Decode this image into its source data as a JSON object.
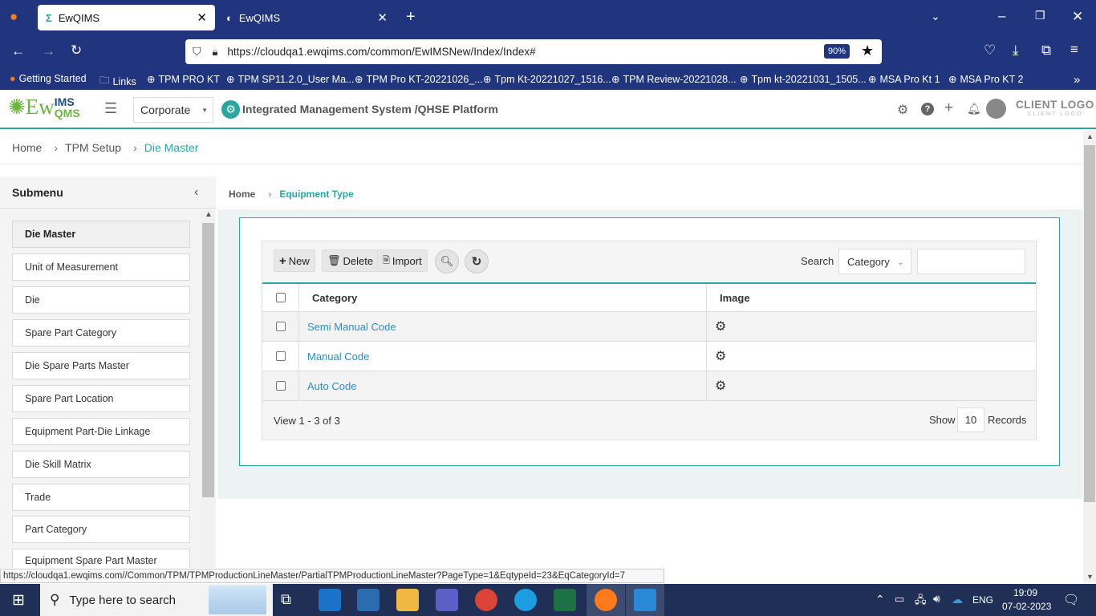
{
  "browser": {
    "tabs": [
      {
        "title": "EwQIMS",
        "active": true
      },
      {
        "title": "EwQIMS",
        "active": false
      }
    ],
    "url": "https://cloudqa1.ewqims.com/common/EwIMSNew/Index/Index#",
    "zoom": "90%",
    "bookmarks": [
      "Getting Started",
      "Links",
      "TPM PRO KT",
      "TPM SP11.2.0_User Ma...",
      "TPM Pro KT-20221026_...",
      "Tpm Kt-20221027_1516...",
      "TPM Review-20221028...",
      "Tpm kt-20221031_1505...",
      "MSA Pro Kt 1",
      "MSA Pro KT 2"
    ]
  },
  "app": {
    "logo_main": "Ew",
    "logo_ims": "IMS",
    "logo_qms": "QMS",
    "org_select": "Corporate",
    "platform_title": "Integrated Management System /QHSE Platform",
    "client_logo": "CLIENT LOGO",
    "client_logo_sub": "CLIENT LOGO"
  },
  "breadcrumb": {
    "home": "Home",
    "setup": "TPM Setup",
    "current": "Die Master"
  },
  "sidebar": {
    "title": "Submenu",
    "items": [
      {
        "label": "Die Master",
        "selected": true
      },
      {
        "label": "Unit of Measurement"
      },
      {
        "label": "Die"
      },
      {
        "label": "Spare Part Category"
      },
      {
        "label": "Die Spare Parts Master"
      },
      {
        "label": "Spare Part Location"
      },
      {
        "label": "Equipment Part-Die Linkage"
      },
      {
        "label": "Die Skill Matrix"
      },
      {
        "label": "Trade"
      },
      {
        "label": "Part Category"
      },
      {
        "label": "Equipment Spare Part Master"
      }
    ]
  },
  "inner_breadcrumb": {
    "home": "Home",
    "current": "Equipment Type"
  },
  "toolbar": {
    "new_label": "New",
    "delete_label": "Delete",
    "import_label": "Import",
    "search_label": "Search",
    "search_field": "Category",
    "search_value": ""
  },
  "table": {
    "headers": [
      "Category",
      "Image"
    ],
    "rows": [
      {
        "category": "Semi Manual Code"
      },
      {
        "category": "Manual Code"
      },
      {
        "category": "Auto Code"
      }
    ],
    "footer_view": "View 1 - 3 of 3",
    "show_label": "Show",
    "page_size": "10",
    "records_label": "Records"
  },
  "status_url": "https://cloudqa1.ewqims.com//Common/TPM/TPMProductionLineMaster/PartialTPMProductionLineMaster?PageType=1&EqtypeId=23&EqCategoryId=7",
  "taskbar": {
    "search_placeholder": "Type here to search",
    "language": "ENG",
    "time": "19:09",
    "date": "07-02-2023"
  },
  "colors": {
    "accent": "#2aa6a0",
    "link": "#2a8fc7",
    "browser": "#21347e"
  }
}
